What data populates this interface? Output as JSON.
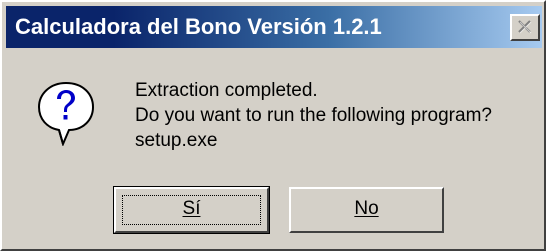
{
  "window": {
    "title": "Calculadora del Bono Versión 1.2.1",
    "close_label": "Close"
  },
  "dialog": {
    "icon": "question-icon",
    "message_lines": [
      "Extraction completed.",
      "Do you want to run the following program?",
      "setup.exe"
    ]
  },
  "buttons": {
    "yes_label": "Sí",
    "no_label": "No"
  },
  "colors": {
    "title_bar_start": "#0a246a",
    "title_bar_end": "#a6caf0",
    "face": "#d4d0c8"
  }
}
